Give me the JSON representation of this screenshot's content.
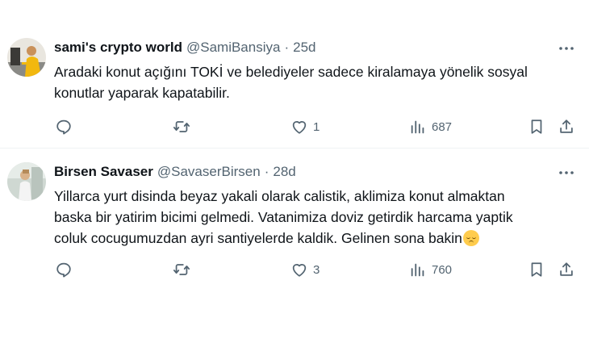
{
  "tweets": [
    {
      "author_name": "sami's crypto world",
      "handle": "@SamiBansiya",
      "separator": "·",
      "time": "25d",
      "text_lines": [
        "Aradaki konut açığını TOKİ ve belediyeler sadece kiralamaya yönelik sosyal",
        "konutlar yaparak kapatabilir."
      ],
      "likes": "1",
      "views": "687",
      "avatar_icon": "profile-photo"
    },
    {
      "author_name": "Birsen Savaser",
      "handle": "@SavaserBirsen",
      "separator": "·",
      "time": "28d",
      "text_lines": [
        "Yillarca yurt disinda beyaz yakali olarak calistik, aklimiza konut almaktan",
        "baska bir yatirim bicimi gelmedi. Vatanimiza doviz getirdik harcama yaptik",
        "coluk cocugumuzdan ayri  santiyelerde kaldik. Gelinen sona bakin"
      ],
      "emoji": "pensive-face",
      "likes": "3",
      "views": "760",
      "avatar_icon": "profile-photo"
    }
  ],
  "colors": {
    "text": "#0f1419",
    "secondary": "#536471",
    "divider": "#eff3f4"
  }
}
